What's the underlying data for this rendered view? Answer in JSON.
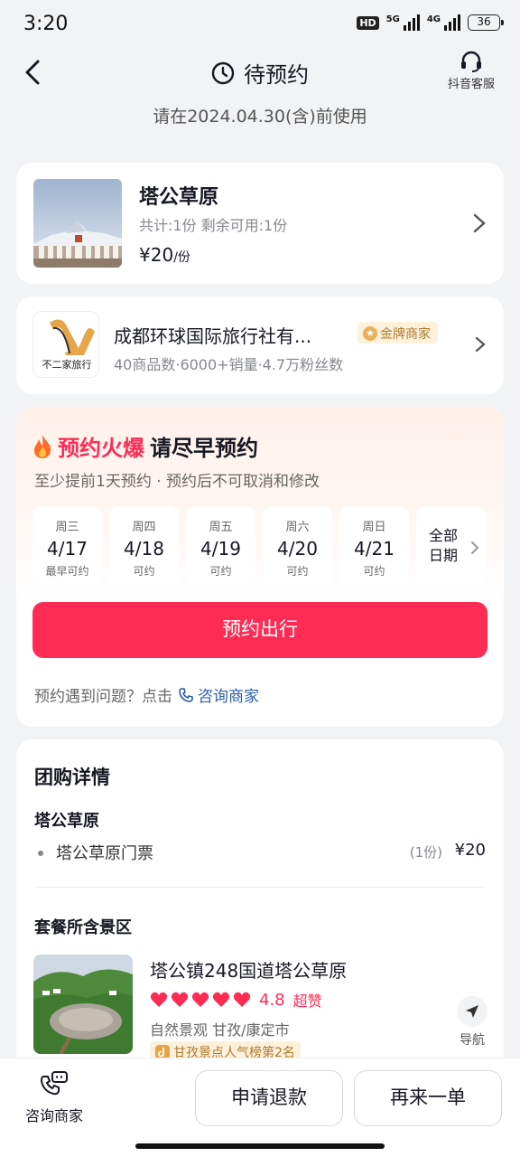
{
  "status_bar": {
    "time": "3:20",
    "hd": "HD",
    "sig1": "5G",
    "sig2": "4G",
    "battery": "36"
  },
  "header": {
    "title": "待预约",
    "service_label": "抖音客服",
    "subtitle": "请在2024.04.30(含)前使用"
  },
  "product": {
    "name": "塔公草原",
    "count_text": "共计:1份   剩余可用:1份",
    "price": "¥20",
    "unit": "/份"
  },
  "merchant": {
    "logo_text": "不二家旅行",
    "name": "成都环球国际旅行社有...",
    "badge": "金牌商家",
    "stats": "40商品数·6000+销量·4.7万粉丝数"
  },
  "booking": {
    "title_hot": "预约火爆",
    "title_rest": "请尽早预约",
    "subtitle": "至少提前1天预约 · 预约后不可取消和修改",
    "days": [
      {
        "weekday": "周三",
        "date": "4/17",
        "status": "最早可约"
      },
      {
        "weekday": "周四",
        "date": "4/18",
        "status": "可约"
      },
      {
        "weekday": "周五",
        "date": "4/19",
        "status": "可约"
      },
      {
        "weekday": "周六",
        "date": "4/20",
        "status": "可约"
      },
      {
        "weekday": "周日",
        "date": "4/21",
        "status": "可约"
      }
    ],
    "all_dates_line1": "全部",
    "all_dates_line2": "日期",
    "reserve_button": "预约出行",
    "help_text": "预约遇到问题？点击",
    "help_link": "咨询商家"
  },
  "details": {
    "title": "团购详情",
    "sub_title": "塔公草原",
    "item_name": "塔公草原门票",
    "item_qty": "(1份)",
    "item_price": "¥20",
    "section": "套餐所含景区",
    "spot_name": "塔公镇248国道塔公草原",
    "rating": "4.8",
    "rating_text": "超赞",
    "tags": "自然景观   甘孜/康定市",
    "rank": "甘孜景点人气榜第2名",
    "nav_label": "导航"
  },
  "bottom": {
    "contact_label": "咨询商家",
    "refund": "申请退款",
    "again": "再来一单"
  },
  "colors": {
    "accent": "#fe2c55",
    "gold_bg": "#fdf1dc",
    "link": "#2f5fa5"
  }
}
